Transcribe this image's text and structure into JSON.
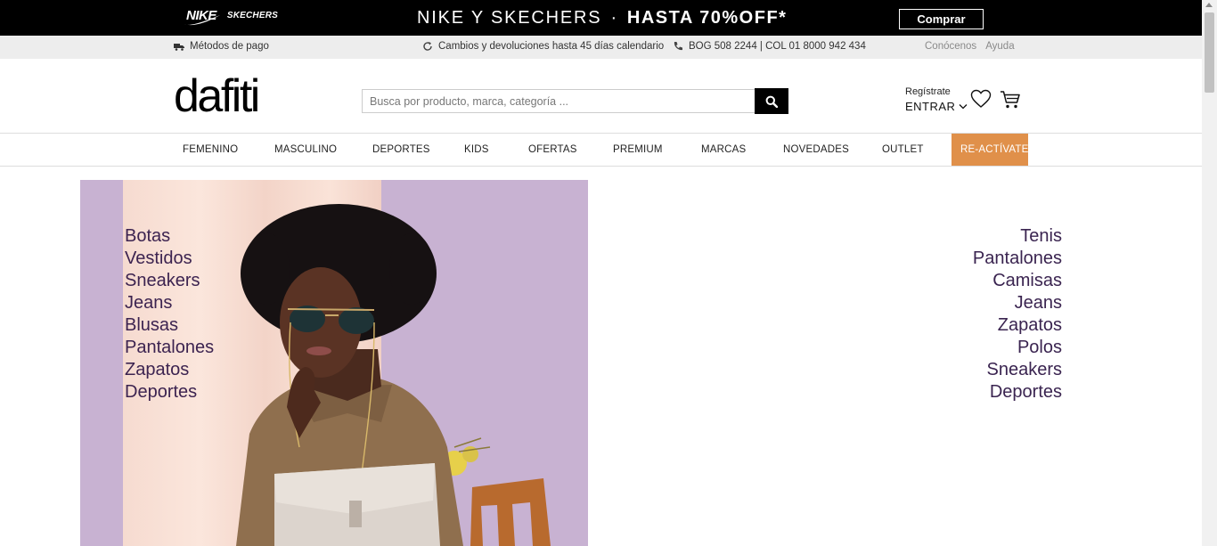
{
  "promo": {
    "brand_nike": "NIKE",
    "brand_skechers": "SKECHERS",
    "headline": "NIKE Y SKECHERS",
    "separator": "·",
    "offer": "HASTA 70%OFF*",
    "cta": "Comprar"
  },
  "info_bar": {
    "payment": "Métodos de pago",
    "returns": "Cambios y devoluciones hasta 45 días calendario",
    "phones": "BOG 508 2244 | COL 01 8000 942 434",
    "about": "Conócenos",
    "help": "Ayuda"
  },
  "header": {
    "logo": "dafiti",
    "search_placeholder": "Busca por producto, marca, categoría ...",
    "register": "Regístrate",
    "login": "ENTRAR"
  },
  "nav": {
    "items": [
      "FEMENINO",
      "MASCULINO",
      "DEPORTES",
      "KIDS",
      "OFERTAS",
      "PREMIUM",
      "MARCAS",
      "NOVEDADES",
      "OUTLET"
    ],
    "highlight": "RE-ACTÍVATE",
    "highlight_color": "#e0904a"
  },
  "women_categories": [
    "Botas",
    "Vestidos",
    "Sneakers",
    "Jeans",
    "Blusas",
    "Pantalones",
    "Zapatos",
    "Deportes"
  ],
  "men_categories": [
    "Tenis",
    "Pantalones",
    "Camisas",
    "Jeans",
    "Zapatos",
    "Polos",
    "Sneakers",
    "Deportes"
  ],
  "colors": {
    "promo_bg": "#000000",
    "info_bg": "#ededed",
    "hero_bg": "#c8b2d2",
    "category_text": "#3c2350"
  }
}
